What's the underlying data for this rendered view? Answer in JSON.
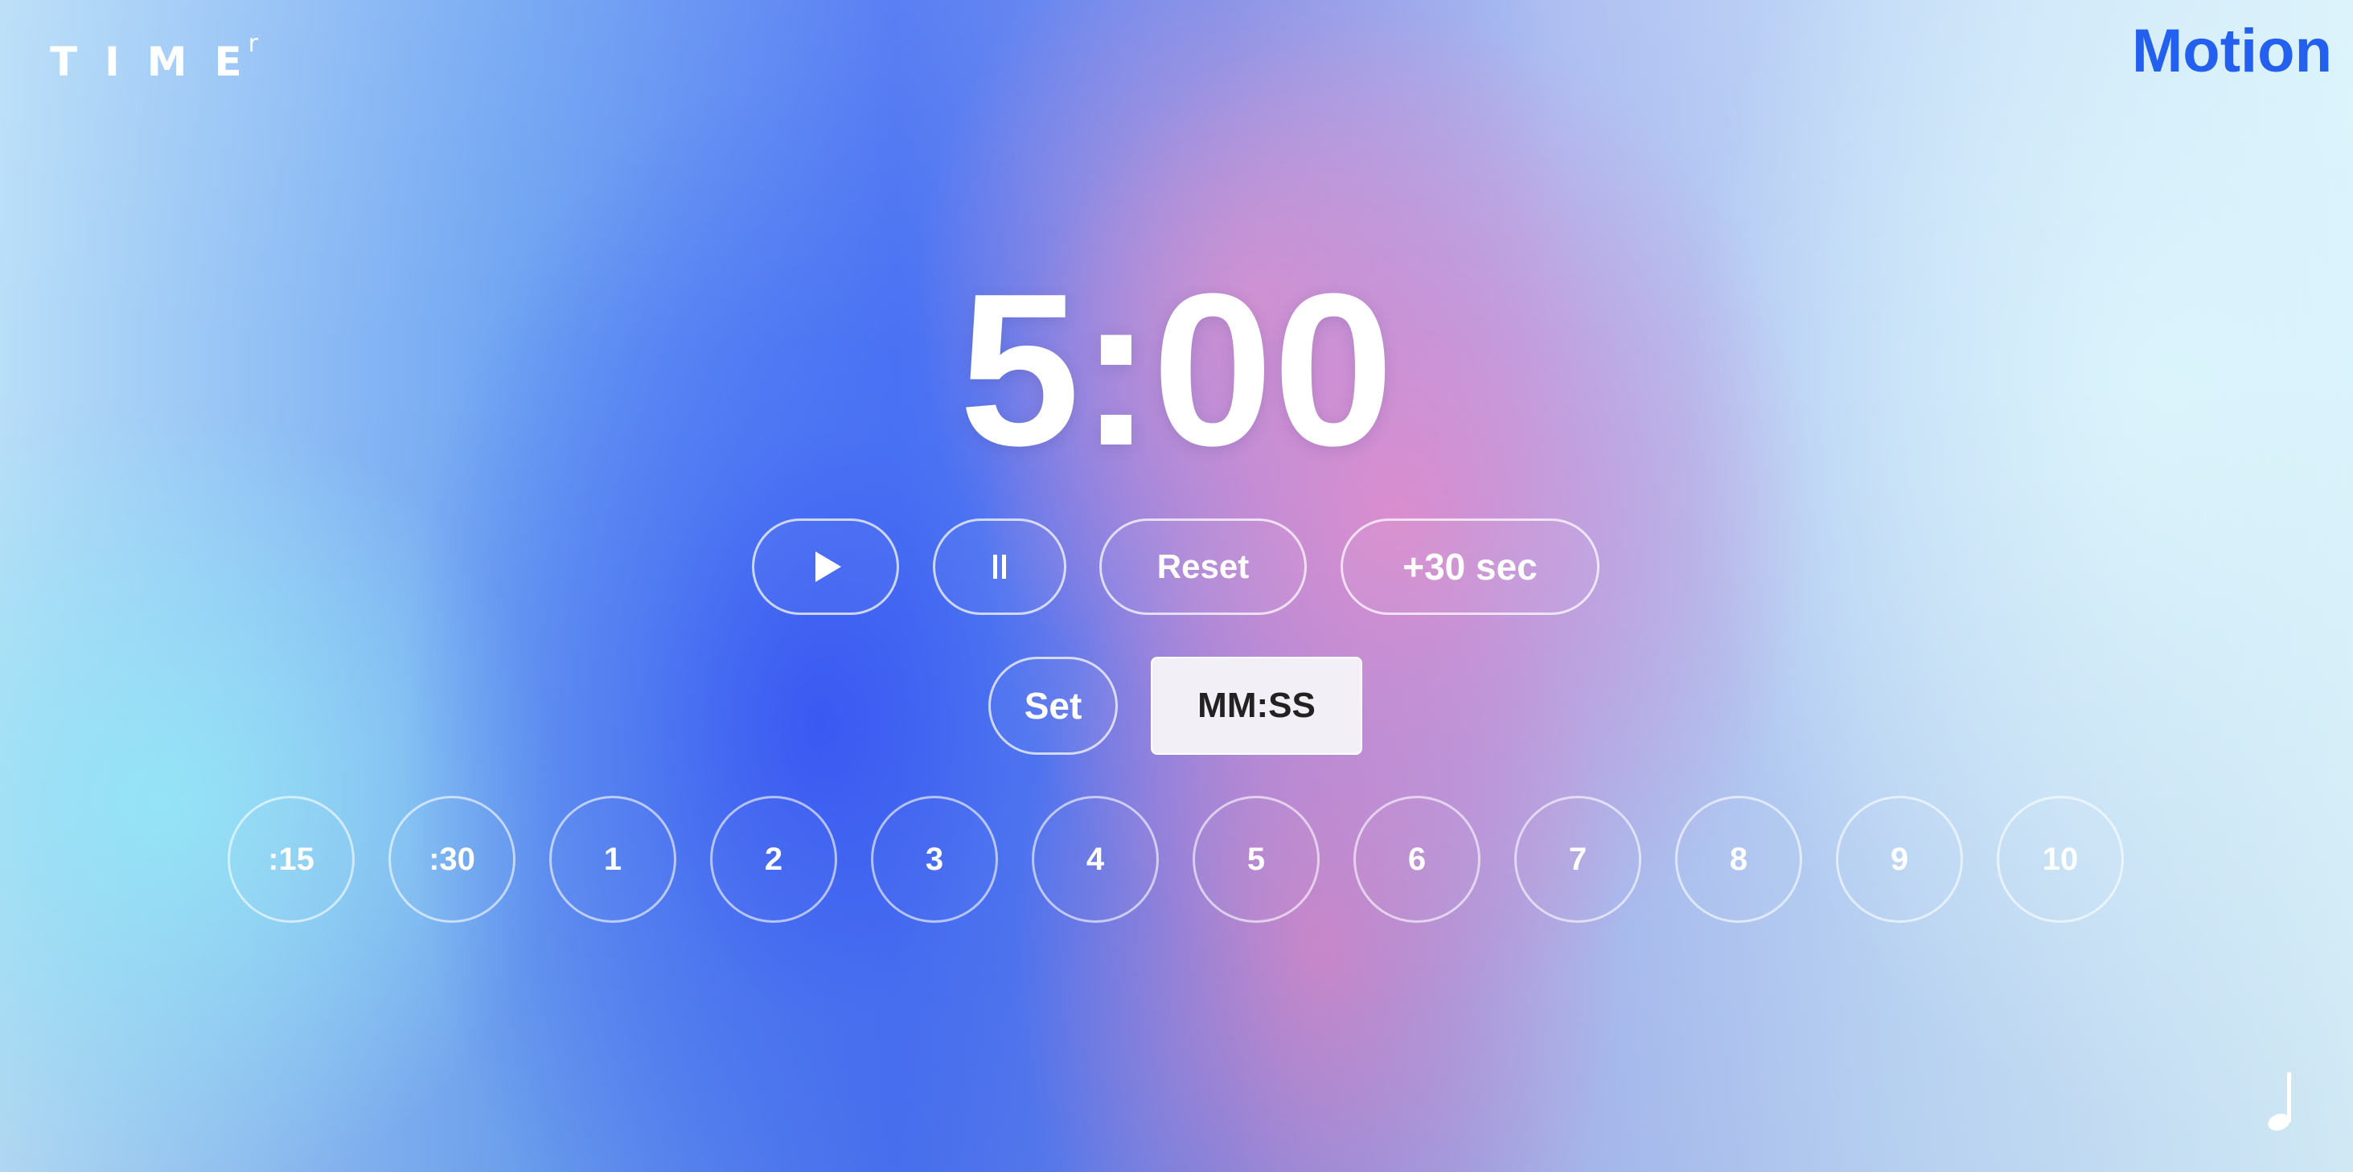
{
  "header": {
    "logo_text": "TIME",
    "logo_superscript": "r",
    "motion_link": "Motion"
  },
  "timer": {
    "display": "5:00"
  },
  "controls": {
    "play_icon": "play-icon",
    "pause_icon": "pause-icon",
    "reset_label": "Reset",
    "add_time_label": "+30 sec"
  },
  "set_time": {
    "set_label": "Set",
    "input_placeholder": "MM:SS"
  },
  "presets": [
    {
      "label": ":15"
    },
    {
      "label": ":30"
    },
    {
      "label": "1"
    },
    {
      "label": "2"
    },
    {
      "label": "3"
    },
    {
      "label": "4"
    },
    {
      "label": "5"
    },
    {
      "label": "6"
    },
    {
      "label": "7"
    },
    {
      "label": "8"
    },
    {
      "label": "9"
    },
    {
      "label": "10"
    }
  ],
  "footer": {
    "music_icon": "music-note-icon"
  },
  "colors": {
    "accent": "#2460f0",
    "text": "#ffffff",
    "input_bg": "#f3eff6"
  }
}
